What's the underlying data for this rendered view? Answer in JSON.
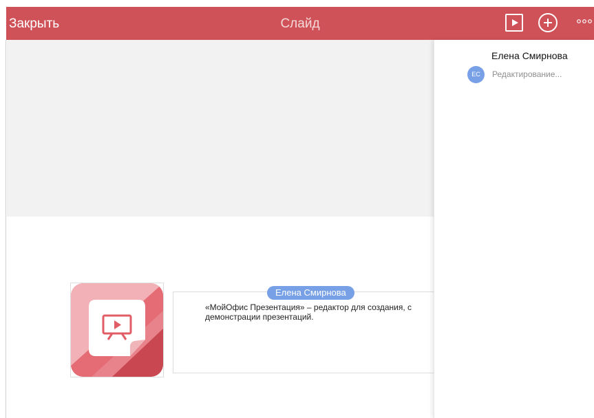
{
  "header": {
    "close_label": "Закрыть",
    "title": "Слайд",
    "icons": [
      "play-icon",
      "plus-circle-icon",
      "more-dots-icon"
    ],
    "accent_color": "#d05259"
  },
  "slide": {
    "text_lines": [
      "«МойОфис Презентация» – редактор для создания, с",
      "демонстрации презентаций."
    ],
    "cursor_badge": "Елена Смирнова",
    "logo_icon": "presentation-app-logo"
  },
  "collaborators": {
    "name": "Елена Смирнова",
    "avatar_initials": "ЕС",
    "status": "Редактирование...",
    "avatar_color": "#78a0e6"
  }
}
